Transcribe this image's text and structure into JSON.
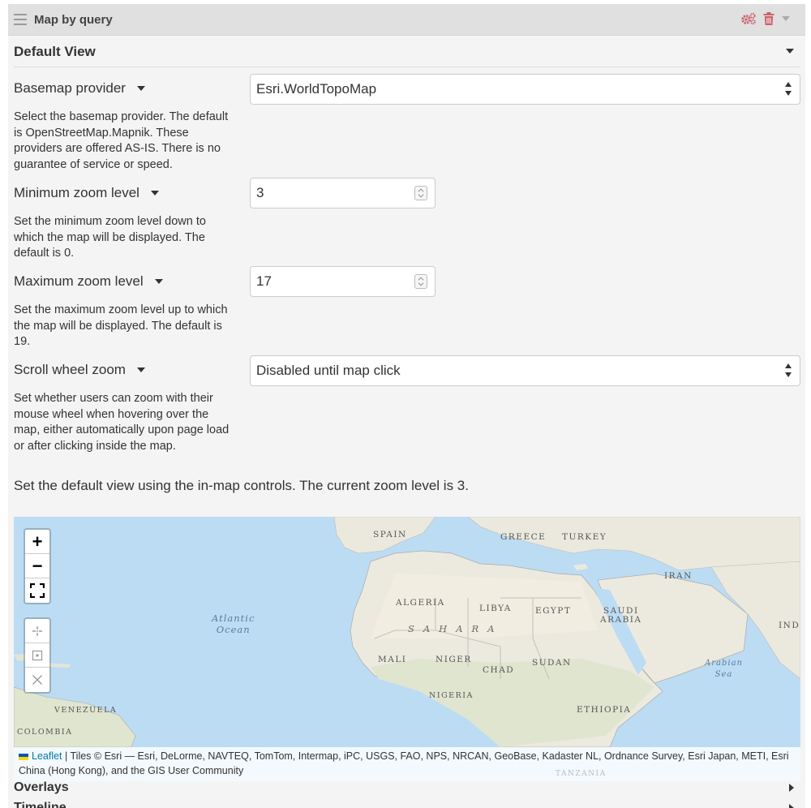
{
  "panel": {
    "title": "Map by query",
    "header_icons": [
      "menu-icon",
      "gears-icon",
      "trash-icon",
      "chevron-down-icon"
    ],
    "accent_color": "#c9636a"
  },
  "section": {
    "title": "Default View"
  },
  "fields": {
    "basemap": {
      "label": "Basemap provider",
      "value": "Esri.WorldTopoMap",
      "help": "Select the basemap provider. The default is OpenStreetMap.Mapnik. These providers are offered AS-IS. There is no guarantee of service or speed."
    },
    "min_zoom": {
      "label": "Minimum zoom level",
      "value": "3",
      "help": "Set the minimum zoom level down to which the map will be displayed. The default is 0."
    },
    "max_zoom": {
      "label": "Maximum zoom level",
      "value": "17",
      "help": "Set the maximum zoom level up to which the map will be displayed. The default is 19."
    },
    "scroll_zoom": {
      "label": "Scroll wheel zoom",
      "value": "Disabled until map click",
      "help": "Set whether users can zoom with their mouse wheel when hovering over the map, either automatically upon page load or after clicking inside the map."
    }
  },
  "view_text": "Set the default view using the in-map controls. The current zoom level is 3.",
  "map": {
    "controls": {
      "zoom_in": "+",
      "zoom_out": "−"
    },
    "labels": {
      "spain": "SPAIN",
      "greece": "GREECE",
      "turkey": "TURKEY",
      "iran": "IRAN",
      "algeria": "ALGERIA",
      "libya": "LIBYA",
      "egypt": "EGYPT",
      "saudi": "SAUDI\nARABIA",
      "ind": "IND",
      "atlantic": "Atlantic\nOcean",
      "sahara": "SAHARA",
      "mali": "MALI",
      "niger": "NIGER",
      "chad": "CHAD",
      "sudan": "SUDAN",
      "arabian_sea": "Arabian\nSea",
      "nigeria": "NIGERIA",
      "ethiopia": "ETHIOPIA",
      "venezuela": "VENEZUELA",
      "colombia": "COLOMBIA",
      "tanzania": "TANZANIA"
    },
    "attribution": {
      "link": "Leaflet",
      "text": " | Tiles © Esri — Esri, DeLorme, NAVTEQ, TomTom, Intermap, iPC, USGS, FAO, NPS, NRCAN, GeoBase, Kadaster NL, Ordnance Survey, Esri Japan, METI, Esri China (Hong Kong), and the GIS User Community"
    }
  },
  "collapsed_sections": {
    "overlays": "Overlays",
    "timeline": "Timeline"
  }
}
